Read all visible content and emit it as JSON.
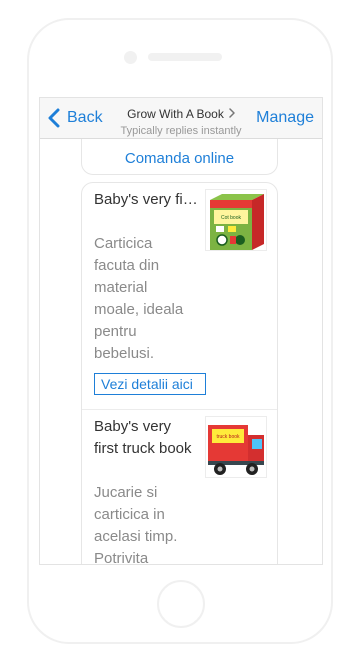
{
  "nav": {
    "back_label": "Back",
    "title": "Grow With A Book",
    "subtitle": "Typically replies instantly",
    "manage_label": "Manage"
  },
  "order": {
    "label": "Comanda online"
  },
  "products": [
    {
      "title": "Baby's very first cot book...",
      "description": "Carticica facuta din material moale, ideala pentru bebelusi.",
      "button_label": "Vezi detalii aici",
      "thumb_text": "Baby's very first Cot book"
    },
    {
      "title": "Baby's very first truck book",
      "description": "Jucarie si carticica in acelasi timp. Potrivita pentru copilasi",
      "thumb_text": "Baby's very first truck book"
    }
  ],
  "colors": {
    "accent": "#1e7fd8",
    "muted_text": "#8a8a8a",
    "border": "#e6e6e6"
  },
  "icons": {
    "back": "chevron-left-icon",
    "title_chevron": "chevron-right-icon"
  }
}
